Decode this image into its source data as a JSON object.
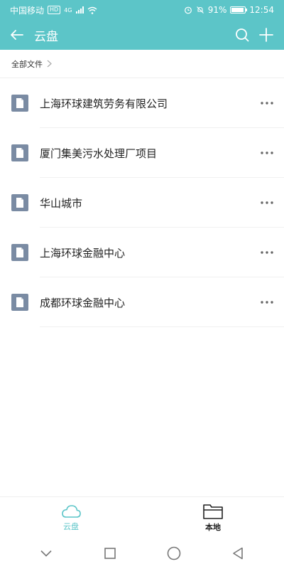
{
  "status_bar": {
    "carrier": "中国移动",
    "badge": "HD",
    "network": "4G",
    "battery": "91%",
    "time": "12:54"
  },
  "app_bar": {
    "title": "云盘"
  },
  "breadcrumb": {
    "label": "全部文件"
  },
  "files": [
    {
      "name": "上海环球建筑劳务有限公司"
    },
    {
      "name": "厦门集美污水处理厂项目"
    },
    {
      "name": "华山城市"
    },
    {
      "name": "上海环球金融中心"
    },
    {
      "name": "成都环球金融中心"
    }
  ],
  "bottom_tabs": [
    {
      "label": "云盘",
      "icon": "cloud-icon",
      "active": true
    },
    {
      "label": "本地",
      "icon": "folder-icon",
      "active": false
    }
  ],
  "colors": {
    "accent": "#5cc5c8",
    "file_icon": "#7a8ba3"
  }
}
